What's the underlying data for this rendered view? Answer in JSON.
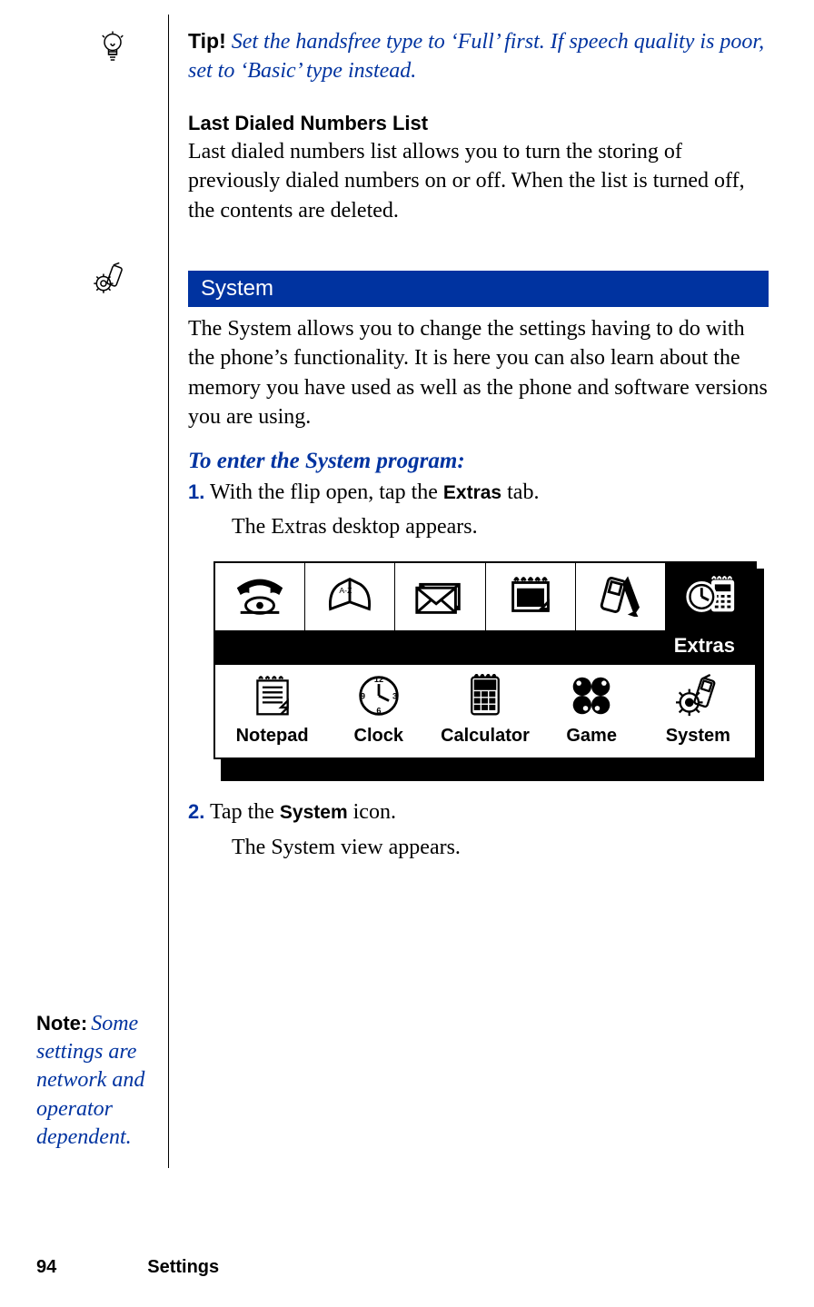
{
  "tip": {
    "label": "Tip!",
    "text": "Set the handsfree type to ‘Full’ first. If speech quality is poor, set to ‘Basic’ type instead."
  },
  "last_dialed": {
    "heading": "Last Dialed Numbers List",
    "body": "Last dialed numbers list allows you to turn the storing of previously dialed numbers on or off. When the list is turned off, the contents are deleted."
  },
  "system": {
    "banner": "System",
    "intro": "The System allows you to change the settings having to do with the phone’s functionality. It is here you can also learn about the memory you have used as well as the phone and software versions you are using.",
    "proc_title": "To enter the System program:",
    "steps": {
      "s1_num": "1.",
      "s1_a": "With the flip open, tap the ",
      "s1_bold": "Extras",
      "s1_b": " tab.",
      "s1_result": "The Extras desktop appears.",
      "s2_num": "2.",
      "s2_a": "Tap the ",
      "s2_bold": "System",
      "s2_b": " icon.",
      "s2_result": "The System view appears."
    }
  },
  "extras_fig": {
    "bar_label": "Extras",
    "apps": {
      "notepad": "Notepad",
      "clock": "Clock",
      "calculator": "Calculator",
      "game": "Game",
      "system": "System"
    },
    "clock_numbers": {
      "n12": "12",
      "n3": "3",
      "n6": "6",
      "n9": "9"
    }
  },
  "note": {
    "label": "Note:",
    "text": "Some settings are network and operator dependent."
  },
  "footer": {
    "page_number": "94",
    "section": "Settings"
  }
}
